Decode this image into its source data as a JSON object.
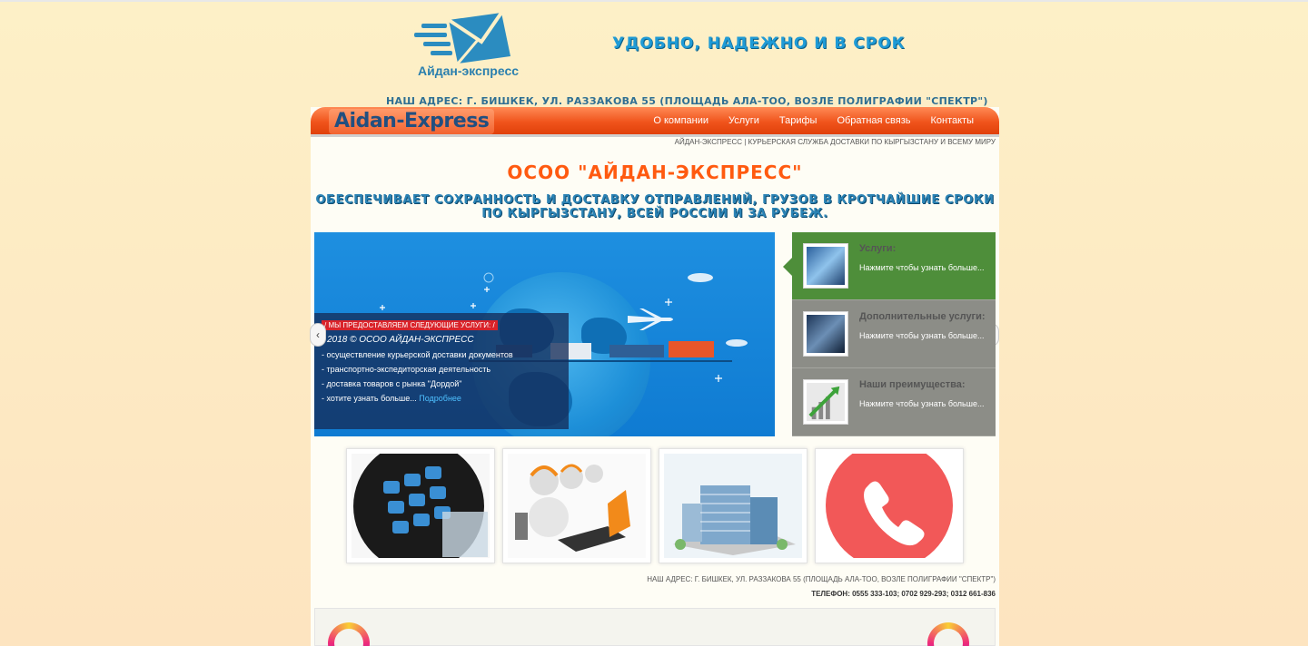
{
  "header": {
    "logo_text": "Айдан-экспресс",
    "slogan": "УДОБНО, НАДЕЖНО И В СРОК",
    "address": "НАШ АДРЕС: Г. БИШКЕК, УЛ. РАЗЗАКОВА 55 (ПЛОЩАДЬ АЛА-ТОО, ВОЗЛЕ ПОЛИГРАФИИ \"СПЕКТР\")"
  },
  "nav": {
    "brand": "Aidan-Express",
    "items": [
      "О компании",
      "Услуги",
      "Тарифы",
      "Обратная связь",
      "Контакты"
    ]
  },
  "tagline": "АЙДАН-ЭКСПРЕСС | КУРЬЕРСКАЯ СЛУЖБА ДОСТАВКИ ПО КЫРГЫЗСТАНУ И ВСЕМУ МИРУ",
  "headline": "ОСОО \"АЙДАН-ЭКСПРЕСС\"",
  "subhead_line1": "ОБЕСПЕЧИВАЕТ СОХРАННОСТЬ И ДОСТАВКУ ОТПРАВЛЕНИЙ, ГРУЗОВ В КРОТЧАЙШИЕ СРОКИ",
  "subhead_line2": "ПО КЫРГЫЗСТАНУ, ВСЕЙ РОССИИ И ЗА РУБЕЖ.",
  "slider": {
    "caption_title": "/ МЫ ПРЕДОСТАВЛЯЕМ СЛЕДУЮЩИЕ УСЛУГИ: /",
    "copyright": "- 2018 © ОСОО АЙДАН-ЭКСПРЕСС",
    "line1": "- осуществление курьерской доставки документов",
    "line2": "- транспортно-экспедиторская деятельность",
    "line3": "- доставка товаров с рынка \"Дордой\"",
    "line4": "- хотите узнать больше...",
    "more_link": "Подробнее",
    "prev_arrow": "‹",
    "next_arrow": "›"
  },
  "tabs": [
    {
      "title": "Услуги:",
      "desc": "Нажмите чтобы узнать больше..."
    },
    {
      "title": "Дополнительные услуги:",
      "desc": "Нажмите чтобы узнать больше..."
    },
    {
      "title": "Наши преимущества:",
      "desc": "Нажмите чтобы узнать больше..."
    }
  ],
  "tiles": [
    "calculator-image",
    "call-center-image",
    "office-building-image",
    "phone-image"
  ],
  "footer": {
    "address": "НАШ АДРЕС: Г. БИШКЕК, УЛ. РАЗЗАКОВА 55 (ПЛОЩАДЬ АЛА-ТОО, ВОЗЛЕ ПОЛИГРАФИИ \"СПЕКТР\")",
    "phone": "ТЕЛЕФОН: 0555 333-103; 0702 929-293; 0312 661-836"
  },
  "colors": {
    "nav_orange": "#f0541c",
    "headline_orange": "#ff5a10",
    "subhead_blue": "#2b83b5",
    "tab_green": "#4e8e3a",
    "tab_gray": "#8c8d87"
  }
}
